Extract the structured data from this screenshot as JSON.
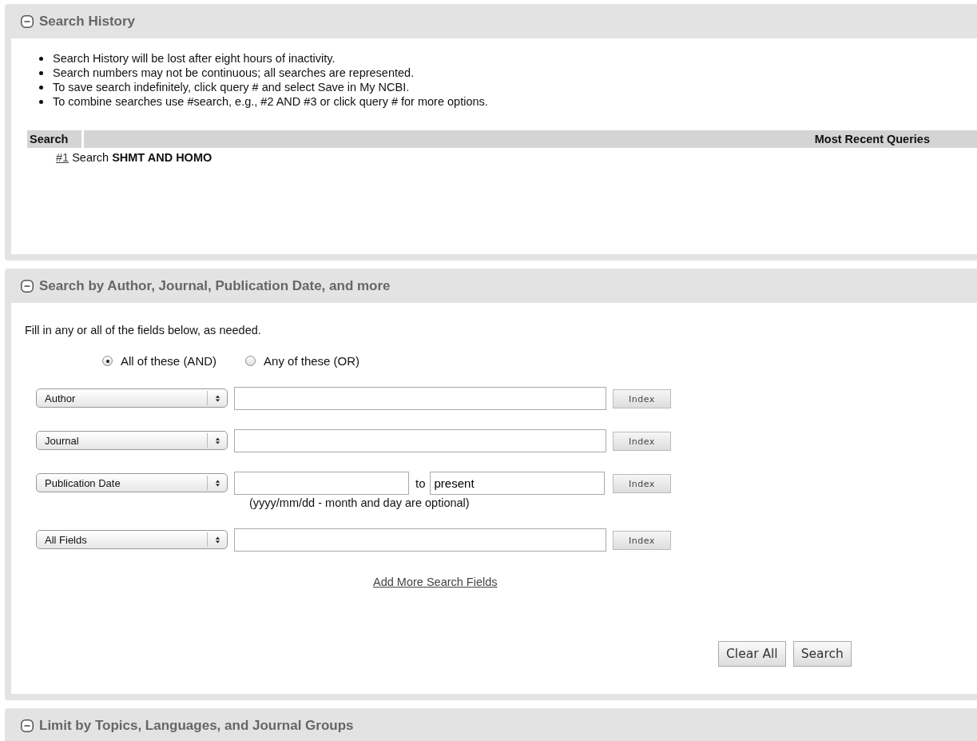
{
  "history": {
    "title": "Search History",
    "expanded": true,
    "notes": [
      "Search History will be lost after eight hours of inactivity.",
      "Search numbers may not be continuous; all searches are represented.",
      "To save search indefinitely, click query # and select Save in My NCBI.",
      "To combine searches use #search, e.g., #2 AND #3 or click query # for more options."
    ],
    "table": {
      "columns": [
        "Search",
        "Most Recent Queries"
      ],
      "rows": [
        {
          "number": "#1",
          "query": "Search **SHMT AND HOMO**"
        }
      ]
    }
  },
  "builder": {
    "title": "Search by Author, Journal, Publication Date, and more",
    "expanded": true,
    "intro": "Fill in any or all of the fields below, as needed.",
    "modes": [
      {
        "label": "All of these (AND)",
        "selected": true
      },
      {
        "label": "Any of these (OR)",
        "selected": false
      }
    ],
    "rows": [
      {
        "kind": "single",
        "field": "Author",
        "button": "Index"
      },
      {
        "kind": "single",
        "field": "Journal",
        "button": "Index"
      },
      {
        "kind": "range",
        "field": "Publication Date",
        "separator": "to",
        "to_value": "present",
        "hint": "(yyyy/mm/dd - month and day are optional)",
        "button": "Index"
      },
      {
        "kind": "single",
        "field": "All Fields",
        "button": "Index"
      }
    ],
    "add_link": "Add More Search Fields",
    "buttons": [
      "Clear All",
      "Search"
    ]
  },
  "limits": {
    "title": "Limit by Topics, Languages, and Journal Groups",
    "expanded": true
  }
}
